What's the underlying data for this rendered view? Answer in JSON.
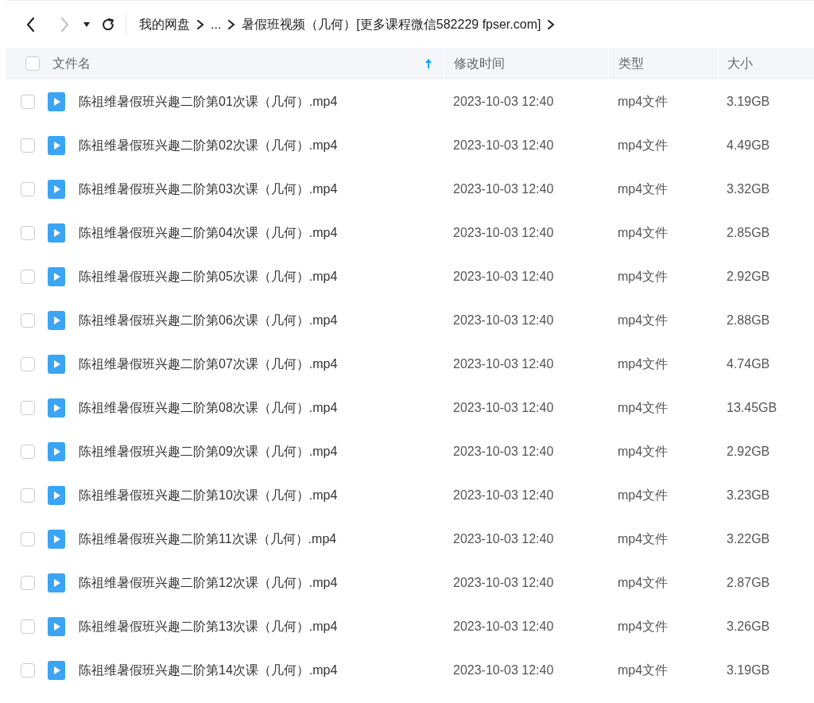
{
  "toolbar": {
    "back_enabled": true,
    "forward_enabled": false
  },
  "breadcrumb": [
    {
      "label": "我的网盘"
    },
    {
      "label": "..."
    },
    {
      "label": "暑假班视频（几何）[更多课程微信582229 fpser.com]"
    }
  ],
  "table": {
    "select_all": {
      "checked": false
    },
    "columns": [
      {
        "label": "文件名",
        "sorted": true
      },
      {
        "label": "修改时间",
        "sorted": false
      },
      {
        "label": "类型",
        "sorted": false
      },
      {
        "label": "大小",
        "sorted": false
      }
    ],
    "rows": [
      {
        "checked": false,
        "name": "陈祖维暑假班兴趣二阶第01次课（几何）.mp4",
        "modified": "2023-10-03 12:40",
        "type": "mp4文件",
        "size": "3.19GB"
      },
      {
        "checked": false,
        "name": "陈祖维暑假班兴趣二阶第02次课（几何）.mp4",
        "modified": "2023-10-03 12:40",
        "type": "mp4文件",
        "size": "4.49GB"
      },
      {
        "checked": false,
        "name": "陈祖维暑假班兴趣二阶第03次课（几何）.mp4",
        "modified": "2023-10-03 12:40",
        "type": "mp4文件",
        "size": "3.32GB"
      },
      {
        "checked": false,
        "name": "陈祖维暑假班兴趣二阶第04次课（几何）.mp4",
        "modified": "2023-10-03 12:40",
        "type": "mp4文件",
        "size": "2.85GB"
      },
      {
        "checked": false,
        "name": "陈祖维暑假班兴趣二阶第05次课（几何）.mp4",
        "modified": "2023-10-03 12:40",
        "type": "mp4文件",
        "size": "2.92GB"
      },
      {
        "checked": false,
        "name": "陈祖维暑假班兴趣二阶第06次课（几何）.mp4",
        "modified": "2023-10-03 12:40",
        "type": "mp4文件",
        "size": "2.88GB"
      },
      {
        "checked": false,
        "name": "陈祖维暑假班兴趣二阶第07次课（几何）.mp4",
        "modified": "2023-10-03 12:40",
        "type": "mp4文件",
        "size": "4.74GB"
      },
      {
        "checked": false,
        "name": "陈祖维暑假班兴趣二阶第08次课（几何）.mp4",
        "modified": "2023-10-03 12:40",
        "type": "mp4文件",
        "size": "13.45GB"
      },
      {
        "checked": false,
        "name": "陈祖维暑假班兴趣二阶第09次课（几何）.mp4",
        "modified": "2023-10-03 12:40",
        "type": "mp4文件",
        "size": "2.92GB"
      },
      {
        "checked": false,
        "name": "陈祖维暑假班兴趣二阶第10次课（几何）.mp4",
        "modified": "2023-10-03 12:40",
        "type": "mp4文件",
        "size": "3.23GB"
      },
      {
        "checked": false,
        "name": "陈祖维暑假班兴趣二阶第11次课（几何）.mp4",
        "modified": "2023-10-03 12:40",
        "type": "mp4文件",
        "size": "3.22GB"
      },
      {
        "checked": false,
        "name": "陈祖维暑假班兴趣二阶第12次课（几何）.mp4",
        "modified": "2023-10-03 12:40",
        "type": "mp4文件",
        "size": "2.87GB"
      },
      {
        "checked": false,
        "name": "陈祖维暑假班兴趣二阶第13次课（几何）.mp4",
        "modified": "2023-10-03 12:40",
        "type": "mp4文件",
        "size": "3.26GB"
      },
      {
        "checked": false,
        "name": "陈祖维暑假班兴趣二阶第14次课（几何）.mp4",
        "modified": "2023-10-03 12:40",
        "type": "mp4文件",
        "size": "3.19GB"
      }
    ]
  }
}
